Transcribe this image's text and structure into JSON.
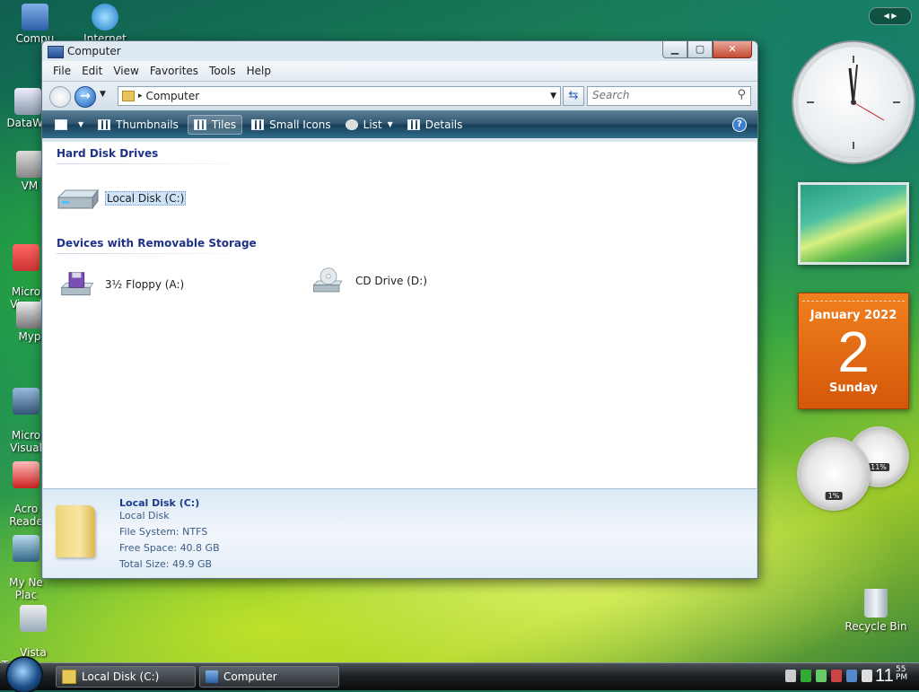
{
  "desktop": {
    "icons": [
      {
        "label": "Compu"
      },
      {
        "label": "Internet"
      },
      {
        "label": "DataWa"
      },
      {
        "label": "VM"
      },
      {
        "label": "Micro\nVisual"
      },
      {
        "label": "Myp"
      },
      {
        "label": "Micro\nVisual"
      },
      {
        "label": "Acro\nReade"
      },
      {
        "label": "My Ne\nPlac"
      },
      {
        "label": "Vista\nTransform..."
      }
    ],
    "recycle_bin": "Recycle Bin"
  },
  "gadgets": {
    "calendar": {
      "month": "January 2022",
      "day": "2",
      "weekday": "Sunday"
    },
    "cpu_meter": {
      "cpu": "1%",
      "memory": "11%"
    }
  },
  "window": {
    "title": "Computer",
    "menu": [
      "File",
      "Edit",
      "View",
      "Favorites",
      "Tools",
      "Help"
    ],
    "address": {
      "crumb": "Computer"
    },
    "search": {
      "placeholder": "Search"
    },
    "toolbar": {
      "views": "",
      "thumbnails": "Thumbnails",
      "tiles": "Tiles",
      "small_icons": "Small Icons",
      "list": "List",
      "details": "Details"
    },
    "groups": [
      {
        "header": "Hard Disk Drives",
        "items": [
          {
            "label": "Local Disk (C:)"
          }
        ]
      },
      {
        "header": "Devices with Removable Storage",
        "items": [
          {
            "label": "3½ Floppy (A:)"
          },
          {
            "label": "CD Drive (D:)"
          }
        ]
      }
    ],
    "details_pane": {
      "name": "Local Disk (C:)",
      "type": "Local Disk",
      "file_system": "File System: NTFS",
      "free_space": "Free Space: 40.8 GB",
      "total_size": "Total Size: 49.9 GB"
    }
  },
  "taskbar": {
    "buttons": [
      {
        "label": "Local Disk (C:)"
      },
      {
        "label": "Computer"
      }
    ],
    "clock": {
      "hour": "11",
      "minute": "55",
      "ampm": "PM"
    }
  }
}
